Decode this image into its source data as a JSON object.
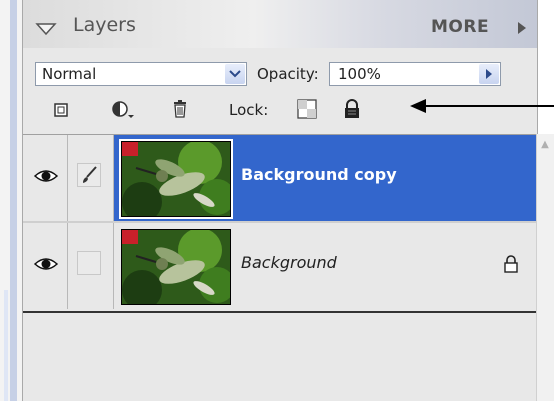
{
  "panel": {
    "title": "Layers",
    "more_label": "MORE"
  },
  "blend_mode": {
    "selected": "Normal"
  },
  "opacity": {
    "label": "Opacity:",
    "value": "100%"
  },
  "lock": {
    "label": "Lock:"
  },
  "layers": [
    {
      "name": "Background copy",
      "selected": true,
      "visible": true,
      "locked": false
    },
    {
      "name": "Background",
      "selected": false,
      "visible": true,
      "locked": true
    }
  ],
  "colors": {
    "selection": "#3366cc",
    "panel_bg": "#e8e8e8"
  },
  "icons": {
    "collapse": "triangle-down-icon",
    "more": "triangle-right-icon",
    "new_layer": "new-layer-icon",
    "adjustment": "adjustment-layer-icon",
    "trash": "trash-icon",
    "lock_transparency": "lock-transparency-icon",
    "lock_all": "padlock-icon",
    "visibility": "eye-icon",
    "link": "brush-icon"
  }
}
